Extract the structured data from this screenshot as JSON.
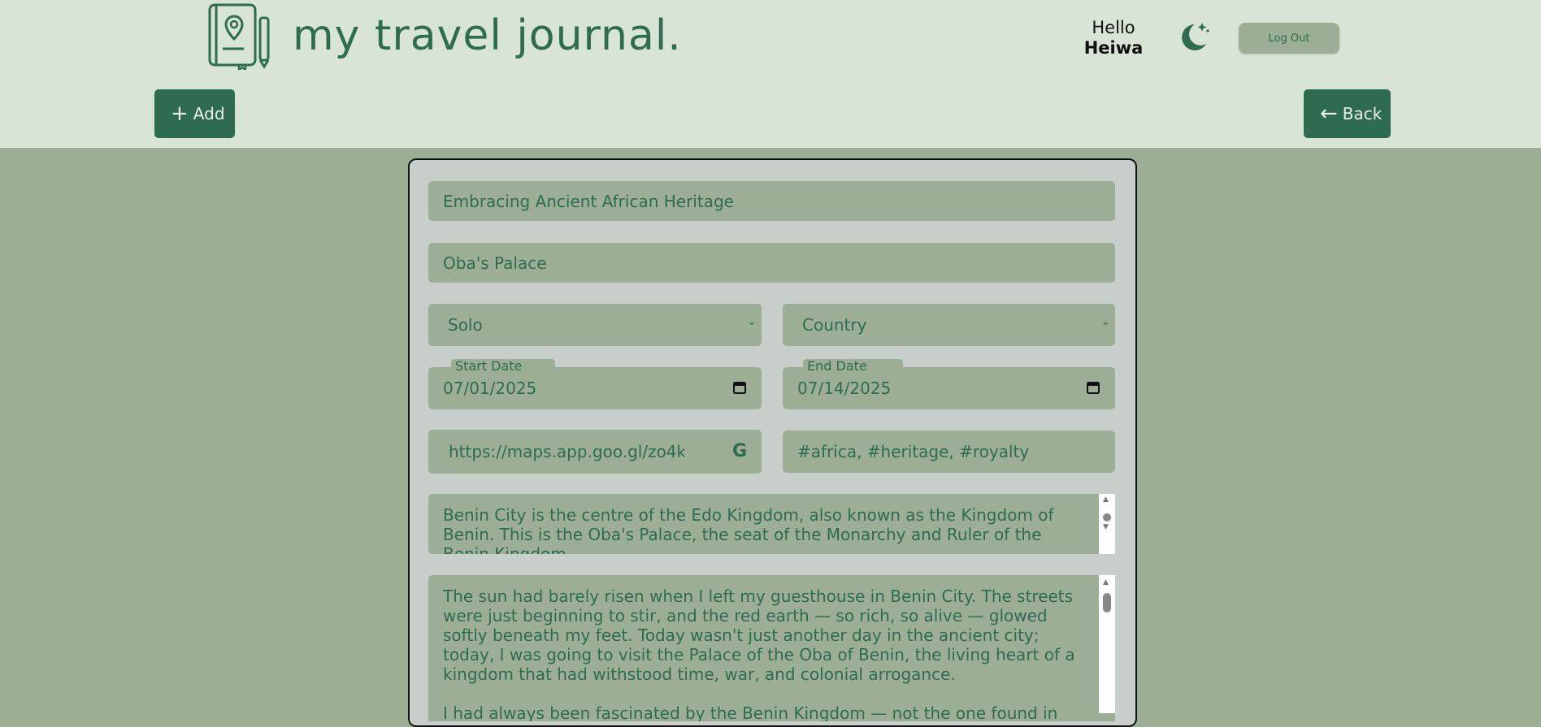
{
  "header": {
    "brand": "my travel journal.",
    "greeting": "Hello",
    "username": "Heiwa",
    "logout_label": "Log Out",
    "add_label": "Add",
    "back_label": "Back"
  },
  "form": {
    "title": "Embracing Ancient African Heritage",
    "location": "Oba's Palace",
    "travel_type": "Solo",
    "country_placeholder": "Country",
    "start_date_label": "Start Date",
    "start_date": "07/01/2025",
    "end_date_label": "End Date",
    "end_date": "07/14/2025",
    "map_link": "https://maps.app.goo.gl/zo4k",
    "tags": "#africa, #heritage, #royalty",
    "description": "Benin City is the centre of the Edo Kingdom, also known as the Kingdom of Benin. This is the Oba's Palace, the seat of the Monarchy and Ruler of the Benin Kingdom.",
    "story_p1": "The sun had barely risen when I left my guesthouse in Benin City. The streets were just beginning to stir, and the red earth — so rich, so alive — glowed softly beneath my feet. Today wasn't just another day in the ancient city; today, I was going to visit the Palace of the Oba of Benin, the living heart of a kingdom that had withstood time, war, and colonial arrogance.",
    "story_p2": "I had always been fascinated by the Benin Kingdom — not the one found in"
  },
  "colors": {
    "accent": "#2f6b50",
    "header_bg": "#d8e4d5",
    "field_bg": "#9caf96",
    "card_bg": "#c8cfcb"
  }
}
